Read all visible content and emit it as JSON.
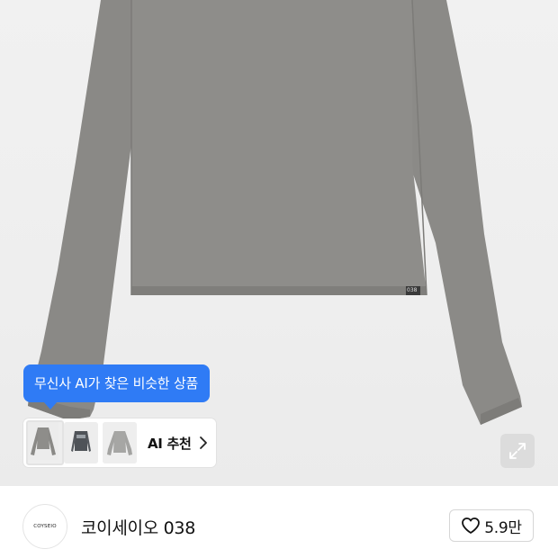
{
  "product": {
    "image_alt": "Long sleeve top, gray",
    "label_tag": "038"
  },
  "ai_similar": {
    "tooltip_text": "무신사 AI가 찾은 비슷한 상품",
    "recommend_label": "AI 추천",
    "thumbnails": [
      "gray-long-sleeve",
      "charcoal-long-sleeve",
      "light-gray-long-sleeve"
    ]
  },
  "brand": {
    "logo_text": "COYSEIO",
    "name": "코이세이오 038"
  },
  "like": {
    "count": "5.9만"
  },
  "colors": {
    "accent": "#2f7bf5",
    "shirt": "#8c8b88"
  }
}
